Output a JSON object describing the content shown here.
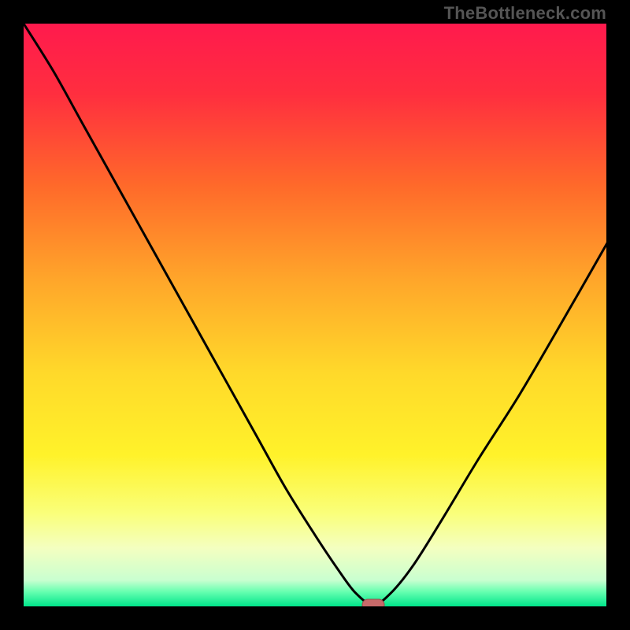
{
  "watermark": "TheBottleneck.com",
  "colors": {
    "frame": "#000000",
    "curve": "#000000",
    "marker_fill": "#c86a6a",
    "marker_stroke": "#9a4a4a",
    "gradient_stops": [
      {
        "offset": 0.0,
        "color": "#ff1a4d"
      },
      {
        "offset": 0.12,
        "color": "#ff2e3f"
      },
      {
        "offset": 0.28,
        "color": "#ff6a2a"
      },
      {
        "offset": 0.44,
        "color": "#ffa62a"
      },
      {
        "offset": 0.6,
        "color": "#ffd92a"
      },
      {
        "offset": 0.74,
        "color": "#fff22a"
      },
      {
        "offset": 0.84,
        "color": "#faff7a"
      },
      {
        "offset": 0.9,
        "color": "#f4ffc0"
      },
      {
        "offset": 0.955,
        "color": "#c9ffd0"
      },
      {
        "offset": 0.975,
        "color": "#66ffb0"
      },
      {
        "offset": 1.0,
        "color": "#00e58a"
      }
    ]
  },
  "chart_data": {
    "type": "line",
    "title": "",
    "xlabel": "",
    "ylabel": "",
    "xlim": [
      0,
      100
    ],
    "ylim": [
      0,
      100
    ],
    "minimum_at_x": 60,
    "x": [
      0,
      5,
      10,
      15,
      20,
      25,
      30,
      35,
      40,
      45,
      50,
      54,
      57,
      60,
      63,
      67,
      72,
      78,
      85,
      92,
      100
    ],
    "values": [
      100,
      92,
      83,
      74,
      65,
      56,
      47,
      38,
      29,
      20,
      12,
      6,
      2,
      0,
      2,
      7,
      15,
      25,
      36,
      48,
      62
    ],
    "marker": {
      "x": 60,
      "y": 0
    }
  }
}
